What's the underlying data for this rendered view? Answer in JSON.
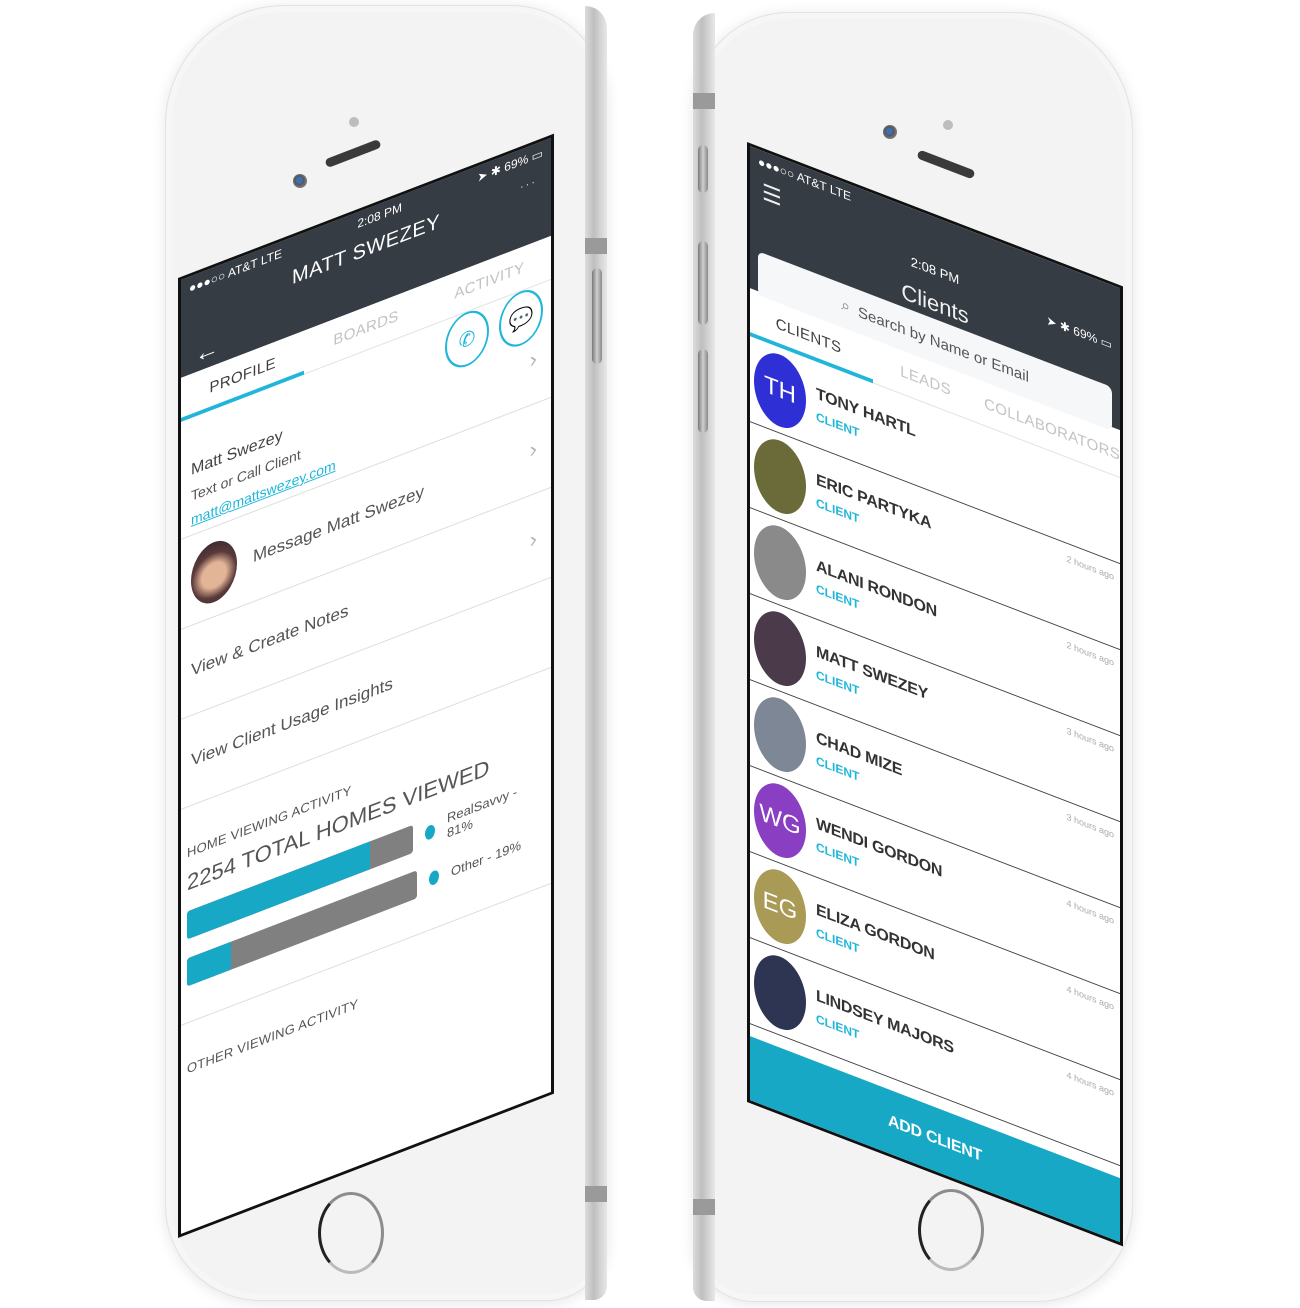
{
  "status_bar": {
    "signal": "●●●○○",
    "carrier": "AT&T",
    "network": "LTE",
    "time": "2:08 PM",
    "battery": "69%"
  },
  "profile_screen": {
    "title": "MATT SWEZEY",
    "more_icon": "···",
    "back_icon": "←",
    "tabs": [
      {
        "label": "PROFILE",
        "active": true
      },
      {
        "label": "BOARDS",
        "active": false
      },
      {
        "label": "ACTIVITY",
        "active": false
      }
    ],
    "contact": {
      "name": "Matt Swezey",
      "subtitle": "Text or Call Client",
      "email": "matt@mattswezey.com"
    },
    "rows": [
      {
        "label": "Message Matt Swezey"
      },
      {
        "label": "View & Create Notes"
      },
      {
        "label": "View Client Usage Insights"
      }
    ],
    "home_viewing": {
      "section_label": "HOME VIEWING ACTIVITY",
      "total_label": "2254 TOTAL HOMES VIEWED",
      "bars": [
        {
          "label": "RealSavvy - 81%",
          "percent": 81
        },
        {
          "label": "Other - 19%",
          "percent": 19
        }
      ]
    },
    "other_section_label": "OTHER VIEWING ACTIVITY",
    "colors": {
      "accent": "#1fb6d9",
      "bar_fill": "#17a8c6",
      "bar_track": "#808080",
      "header": "#363c44"
    }
  },
  "clients_screen": {
    "title": "Clients",
    "search": {
      "placeholder": "Search by Name or Email"
    },
    "more_icon": "···",
    "tabs": [
      {
        "label": "CLIENTS",
        "active": true
      },
      {
        "label": "LEADS",
        "active": false
      },
      {
        "label": "COLLABORATORS",
        "active": false
      }
    ],
    "clients": [
      {
        "name": "TONY HARTL",
        "type": "CLIENT",
        "initials": "TH",
        "avatar_color": "#2f2fd6",
        "time": ""
      },
      {
        "name": "ERIC PARTYKA",
        "type": "CLIENT",
        "initials": "",
        "avatar_color": "#6b6b3a",
        "time": "2 hours ago"
      },
      {
        "name": "ALANI RONDON",
        "type": "CLIENT",
        "initials": "",
        "avatar_color": "#8a8a8a",
        "time": "2 hours ago"
      },
      {
        "name": "MATT SWEZEY",
        "type": "CLIENT",
        "initials": "",
        "avatar_color": "#4a3a4a",
        "time": "3 hours ago"
      },
      {
        "name": "CHAD MIZE",
        "type": "CLIENT",
        "initials": "",
        "avatar_color": "#7d8796",
        "time": "3 hours ago"
      },
      {
        "name": "WENDI GORDON",
        "type": "CLIENT",
        "initials": "WG",
        "avatar_color": "#8a3fc2",
        "time": "4 hours ago"
      },
      {
        "name": "ELIZA GORDON",
        "type": "CLIENT",
        "initials": "EG",
        "avatar_color": "#a99a55",
        "time": "4 hours ago"
      },
      {
        "name": "LINDSEY MAJORS",
        "type": "CLIENT",
        "initials": "",
        "avatar_color": "#2e3552",
        "time": "4 hours ago"
      }
    ],
    "add_button": "ADD CLIENT"
  }
}
